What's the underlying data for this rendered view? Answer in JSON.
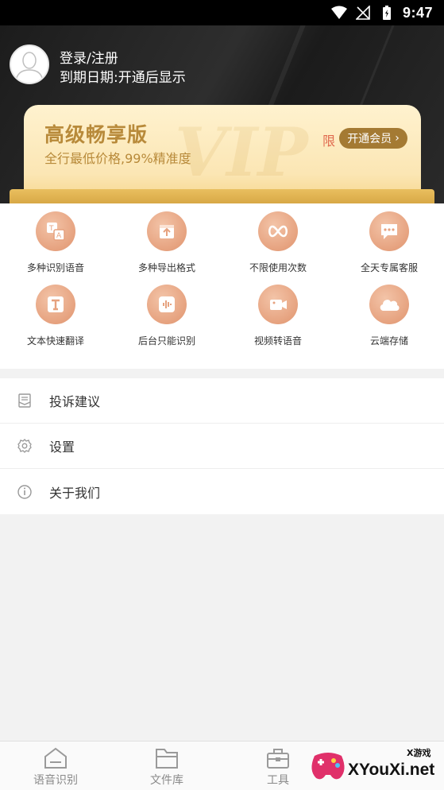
{
  "status_bar": {
    "time": "9:47"
  },
  "user": {
    "login_label": "登录/注册",
    "expiry_text": "到期日期:开通后显示"
  },
  "vip": {
    "watermark": "VIP",
    "title": "高级畅享版",
    "subtitle": "全行最低价格,99%精准度",
    "limit_tag": "限",
    "button_label": "开通会员",
    "button_arrow": "›"
  },
  "features": [
    {
      "label": "多种识别语音",
      "icon": "translate-icon"
    },
    {
      "label": "多种导出格式",
      "icon": "export-icon"
    },
    {
      "label": "不限使用次数",
      "icon": "infinity-icon"
    },
    {
      "label": "全天专属客服",
      "icon": "chat-icon"
    },
    {
      "label": "文本快速翻译",
      "icon": "text-icon"
    },
    {
      "label": "后台只能识别",
      "icon": "audio-wave-icon"
    },
    {
      "label": "视频转语音",
      "icon": "video-icon"
    },
    {
      "label": "云端存储",
      "icon": "cloud-icon"
    }
  ],
  "menu": [
    {
      "label": "投诉建议",
      "icon": "feedback-icon"
    },
    {
      "label": "设置",
      "icon": "gear-icon"
    },
    {
      "label": "关于我们",
      "icon": "info-icon"
    }
  ],
  "tabs": [
    {
      "label": "语音识别",
      "icon": "home-icon"
    },
    {
      "label": "文件库",
      "icon": "folder-icon"
    },
    {
      "label": "工具",
      "icon": "toolbox-icon"
    }
  ],
  "watermark_logo": {
    "brand": "XYouXi.net",
    "small": "X游戏"
  },
  "colors": {
    "accent": "#a47a33",
    "feature_icon": "#e6a27f",
    "limit": "#e06a4e",
    "header_bg": "#1c1c1c"
  }
}
